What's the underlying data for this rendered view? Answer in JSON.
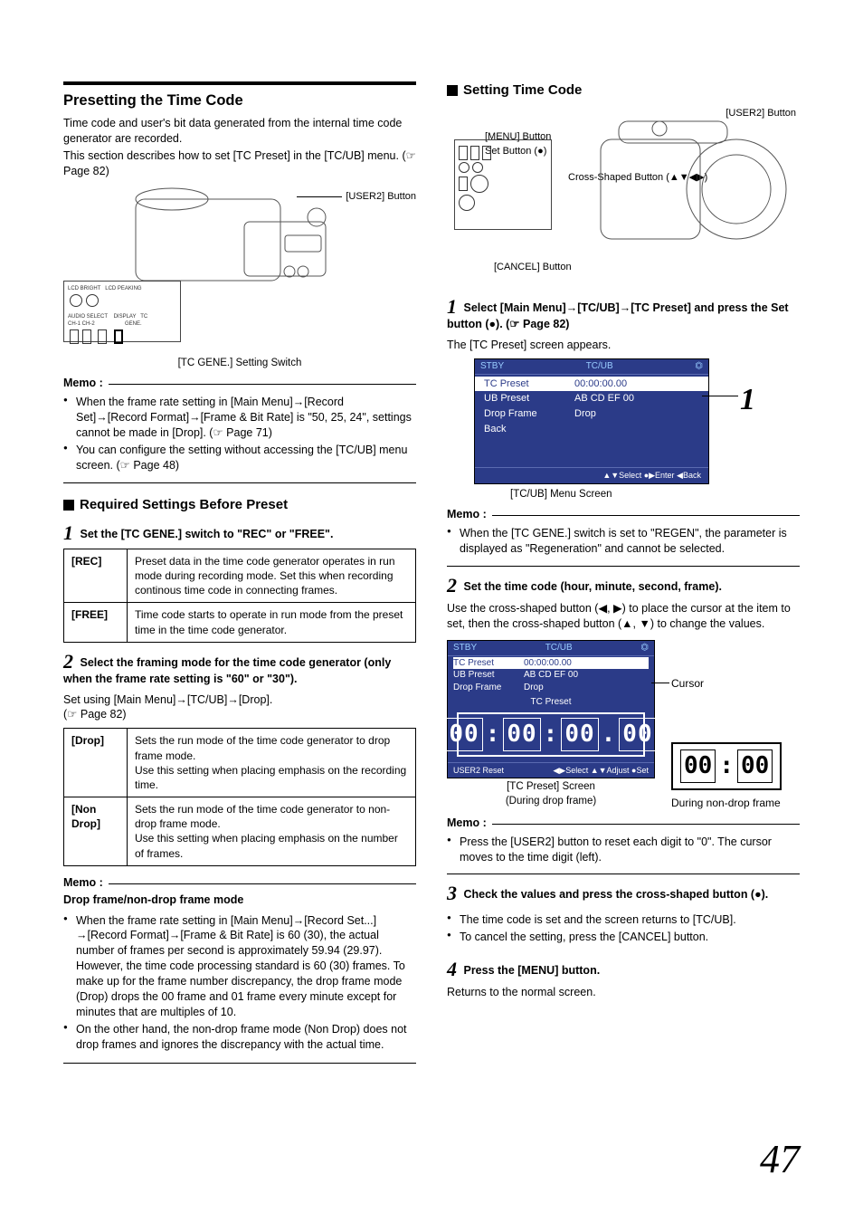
{
  "page_number": "47",
  "left": {
    "h_main": "Presetting the Time Code",
    "intro1": "Time code and user's bit data generated from the internal time code generator are recorded.",
    "intro2_a": "This section describes how to set [TC Preset] in the [TC/UB] menu. (",
    "intro2_ref": " Page 82)",
    "fig1_user2": "[USER2] Button",
    "fig1_caption": "[TC GENE.] Setting Switch",
    "memo_label": "Memo :",
    "memo1_a": "When the frame rate setting in [Main Menu]",
    "memo1_b": "[Record Set]",
    "memo1_c": "[Record Format]",
    "memo1_d": "[Frame & Bit Rate] is \"50, 25, 24\", settings cannot be made in [Drop]. (",
    "memo1_ref": " Page 71)",
    "memo2_a": "You can configure the setting without accessing the [TC/UB] menu screen. (",
    "memo2_ref": " Page 48)",
    "h_sub": "Required Settings Before Preset",
    "step1": "Set the [TC GENE.] switch to \"REC\" or \"FREE\".",
    "tbl1_r1_k": "[REC]",
    "tbl1_r1_v": "Preset data in the time code generator operates in run mode during recording mode. Set this when recording continous time code in connecting frames.",
    "tbl1_r2_k": "[FREE]",
    "tbl1_r2_v": "Time code starts to operate in run mode from the preset time in the time code generator.",
    "step2": "Select the framing mode for the time code generator (only when the frame rate setting is \"60\" or \"30\").",
    "step2_body_a": "Set using [Main Menu]",
    "step2_body_b": "[TC/UB]",
    "step2_body_c": "[Drop].",
    "step2_body_ref": " Page 82)",
    "tbl2_r1_k": "[Drop]",
    "tbl2_r1_v": "Sets the run mode of the time code generator to drop frame mode.\nUse this setting when placing emphasis on the recording time.",
    "tbl2_r2_k": "[Non Drop]",
    "tbl2_r2_v": "Sets the run mode of the time code generator to non-drop frame mode.\nUse this setting when placing emphasis on the number of frames.",
    "memoB_label": "Memo :",
    "memoB_sub": "Drop frame/non-drop frame mode",
    "memoB_1_a": "When the frame rate setting in [Main Menu]",
    "memoB_1_b": "[Record Set...]",
    "memoB_1_c": "[Record Format]",
    "memoB_1_d": "[Frame & Bit Rate] is 60 (30), the actual number of frames per second is approximately 59.94 (29.97). However, the time code processing standard is 60 (30) frames. To make up for the frame number discrepancy, the drop frame mode (Drop) drops the 00 frame and 01 frame every minute except for minutes that are multiples of 10.",
    "memoB_2": "On the other hand, the non-drop frame mode (Non Drop) does not drop frames and ignores the discrepancy with the actual time."
  },
  "right": {
    "h_sub": "Setting Time Code",
    "fig_user2": "[USER2] Button",
    "fig_menu": "[MENU] Button",
    "fig_set": "Set Button (●)",
    "fig_cross": "Cross-Shaped Button (▲▼◀▶)",
    "fig_cancel": "[CANCEL] Button",
    "step1_a": "Select [Main Menu]",
    "step1_b": "[TC/UB]",
    "step1_c": "[TC Preset] and press the Set button (●). (",
    "step1_ref": " Page 82)",
    "step1_body": "The [TC Preset] screen appears.",
    "menu_top_l": "STBY",
    "menu_top_c": "TC/UB",
    "menu_r1_l": "TC Preset",
    "menu_r1_v": "00:00:00.00",
    "menu_r2_l": "UB Preset",
    "menu_r2_v": "AB CD EF 00",
    "menu_r3_l": "Drop Frame",
    "menu_r3_v": "Drop",
    "menu_r4_l": "Back",
    "menu_foot": "▲▼Select   ●▶Enter   ◀Back",
    "menu_caption": "[TC/UB] Menu Screen",
    "menu_annot": "1",
    "memoC_label": "Memo :",
    "memoC_1": "When the [TC GENE.] switch is set to \"REGEN\", the parameter is displayed as \"Regeneration\" and cannot be selected.",
    "step2": "Set the time code (hour, minute, second, frame).",
    "step2_body": "Use the cross-shaped button (◀, ▶) to place the cursor at the item to set, then the cross-shaped button (▲, ▼) to change the values.",
    "tc_top_l": "STBY",
    "tc_top_c": "TC/UB",
    "tc_r1_l": "TC Preset",
    "tc_r1_v": "00:00:00.00",
    "tc_r2_l": "UB Preset",
    "tc_r2_v": "AB CD EF 00",
    "tc_r3_l": "Drop Frame",
    "tc_r3_v": "Drop",
    "tc_sub": "TC Preset",
    "tc_d1": "00",
    "tc_d2": "00",
    "tc_d3": "00",
    "tc_d4": "00",
    "tc_foot_l": "USER2 Reset",
    "tc_foot_r": "◀▶Select ▲▼Adjust ●Set",
    "tc_cursor_label": "Cursor",
    "tc_nd_label": "During non-drop frame",
    "tc_nd_d1": "00",
    "tc_nd_d2": "00",
    "tc_caption1": "[TC Preset] Screen",
    "tc_caption2": "(During drop frame)",
    "memoD_label": "Memo :",
    "memoD_1": "Press the [USER2] button to reset each digit to \"0\". The cursor moves to the time digit (left).",
    "step3": "Check the values and press the cross-shaped button (●).",
    "step3_b1": "The time code is set and the screen returns to [TC/UB].",
    "step3_b2": "To cancel the setting, press the [CANCEL] button.",
    "step4": "Press the [MENU] button.",
    "step4_body": "Returns to the normal screen."
  }
}
